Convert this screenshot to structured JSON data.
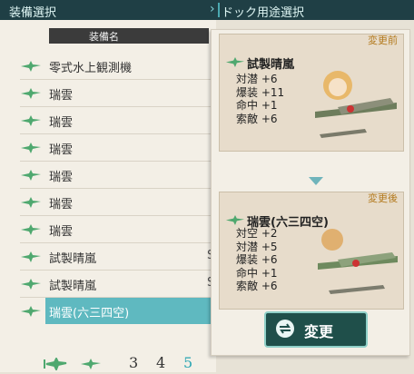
{
  "header": {
    "left_title": "装備選択",
    "right_title": "ドック用途選択"
  },
  "list": {
    "column_header": "装備名",
    "items": [
      {
        "name": "零式水上観測機",
        "suffix": ""
      },
      {
        "name": "瑞雲",
        "suffix": ""
      },
      {
        "name": "瑞雲",
        "suffix": ""
      },
      {
        "name": "瑞雲",
        "suffix": ""
      },
      {
        "name": "瑞雲",
        "suffix": ""
      },
      {
        "name": "瑞雲",
        "suffix": ""
      },
      {
        "name": "瑞雲",
        "suffix": ""
      },
      {
        "name": "試製晴嵐",
        "suffix": "S"
      },
      {
        "name": "試製晴嵐",
        "suffix": "S"
      },
      {
        "name": "瑞雲(六三四空)",
        "suffix": ""
      }
    ],
    "pagination": {
      "pages": [
        "3",
        "4",
        "5"
      ],
      "current": "5"
    }
  },
  "before": {
    "tag": "変更前",
    "name": "試製晴嵐",
    "stats": [
      "対潜 +6",
      "爆装 +11",
      "命中 +1",
      "索敵 +6"
    ]
  },
  "after": {
    "tag": "変更後",
    "name": "瑞雲(六三四空)",
    "stats": [
      "対空 +2",
      "対潜 +5",
      "爆装 +6",
      "命中 +1",
      "索敵 +6"
    ]
  },
  "change_button": {
    "label": "変更"
  },
  "colors": {
    "accent": "#5fb9c0",
    "header_bg": "#1f3f45",
    "icon_green": "#4fa86f"
  }
}
